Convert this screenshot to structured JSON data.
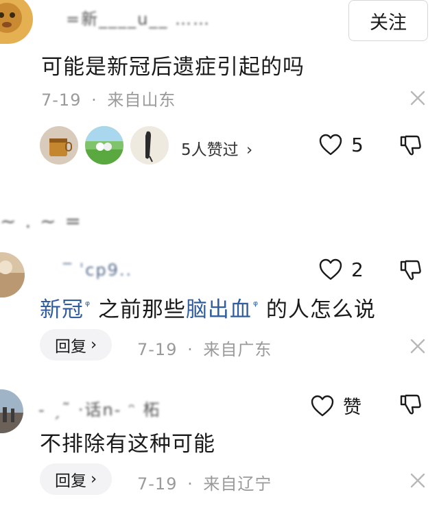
{
  "comments": [
    {
      "username": "=新____u__ ……",
      "follow_label": "关注",
      "text": "可能是新冠后遗症引起的吗",
      "date": "7-19",
      "dot": "·",
      "location": "来自山东",
      "likers_label": "5人赞过",
      "likers_chevron": "›",
      "like_count": "5"
    },
    {
      "username": "‾ ˈcp9..",
      "like_count": "2",
      "text_segments": [
        {
          "text": "新冠",
          "type": "link"
        },
        {
          "text": "之前那些",
          "type": "plain"
        },
        {
          "text": "脑出血",
          "type": "link"
        },
        {
          "text": "的人怎么说",
          "type": "plain"
        }
      ],
      "search_mark": "ᵠ",
      "reply_label": "回复",
      "reply_chevron": "›",
      "date": "7-19",
      "dot": "·",
      "location": "来自广东"
    },
    {
      "username": "- ˏ˜ ·话n- ᵔ 柘",
      "like_label": "赞",
      "text": "不排除有这种可能",
      "reply_label": "回复",
      "reply_chevron": "›",
      "date": "7-19",
      "dot": "·",
      "location": "来自辽宁"
    }
  ],
  "separator_username": "~ . ~ =",
  "colors": {
    "link": "#2f5d9e",
    "meta_gray": "#9a9a9a",
    "reply_bg": "#f3f3f5"
  },
  "icons": [
    "heart-outline-icon",
    "thumbs-down-icon",
    "close-icon",
    "chevron-right-icon"
  ]
}
